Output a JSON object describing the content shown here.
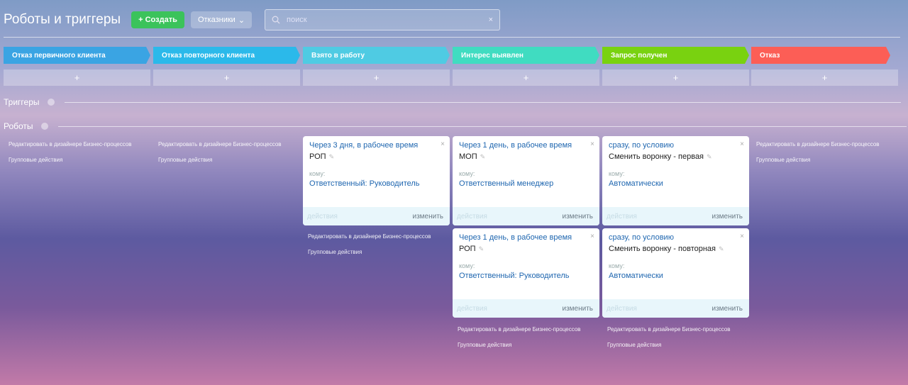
{
  "header": {
    "title": "Роботы и триггеры",
    "create_label": "Создать",
    "funnel_label": "Отказники",
    "search_placeholder": "поиск"
  },
  "stages": [
    {
      "label": "Отказ первичного клиента",
      "color": "#3aa4e3"
    },
    {
      "label": "Отказ повторного клиента",
      "color": "#2bb9ea"
    },
    {
      "label": "Взято в работу",
      "color": "#4fcbe3"
    },
    {
      "label": "Интерес выявлен",
      "color": "#40dcc1"
    },
    {
      "label": "Запрос получен",
      "color": "#79d210"
    },
    {
      "label": "Отказ",
      "color": "#fc5e56"
    }
  ],
  "add_symbol": "+",
  "sections": {
    "triggers": "Триггеры",
    "robots": "Роботы"
  },
  "links": {
    "edit": "Редактировать в дизайнере Бизнес-процессов",
    "group": "Групповые действия"
  },
  "card_labels": {
    "to": "кому:",
    "actions": "действия",
    "change": "изменить"
  },
  "cards": [
    {
      "cond": "Через 3 дня, в рабочее время",
      "name": "РОП",
      "resp": "Ответственный: Руководитель"
    },
    {
      "cond": "Через 1 день, в рабочее время",
      "name": "МОП",
      "resp": "Ответственный менеджер"
    },
    {
      "cond": "сразу, по условию",
      "name": "Сменить воронку - первая",
      "resp": "Автоматически"
    },
    {
      "cond": "Через 1 день, в рабочее время",
      "name": "РОП",
      "resp": "Ответственный: Руководитель"
    },
    {
      "cond": "сразу, по условию",
      "name": "Сменить воронку - повторная",
      "resp": "Автоматически"
    }
  ]
}
